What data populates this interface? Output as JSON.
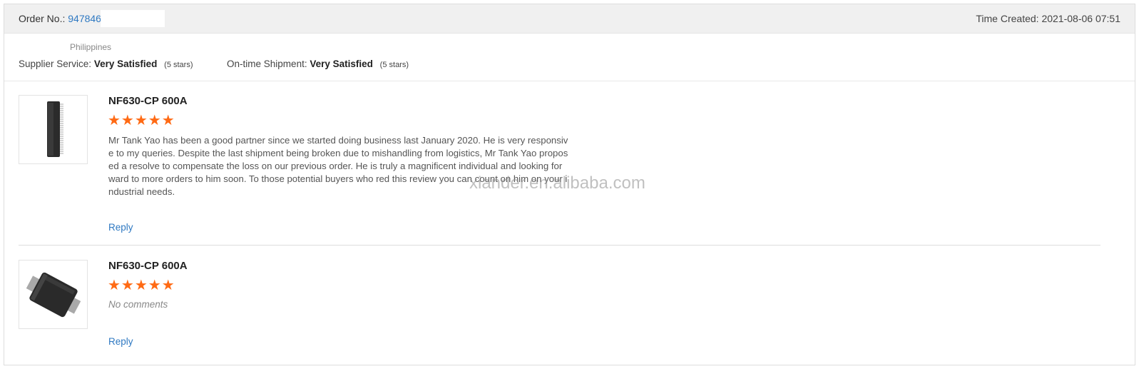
{
  "header": {
    "order_label": "Order No.:",
    "order_number": "9478463",
    "time_created_label": "Time Created:",
    "time_created": "2021-08-06 07:51"
  },
  "buyer": {
    "country": "Philippines"
  },
  "ratings": {
    "supplier_service_label": "Supplier Service:",
    "supplier_service_value": "Very Satisfied",
    "supplier_service_stars": "(5 stars)",
    "shipment_label": "On-time Shipment:",
    "shipment_value": "Very Satisfied",
    "shipment_stars": "(5 stars)"
  },
  "reviews": [
    {
      "product": "NF630-CP 600A",
      "stars": "★★★★★",
      "comment": "Mr Tank Yao has been a good partner since we started doing business last January 2020. He is very responsive to my queries. Despite the last shipment being broken due to mishandling from logistics, Mr Tank Yao proposed a resolve to compensate the loss on our previous order. He is truly a magnificent individual and looking forward to more orders to him soon. To those potential buyers who red this review you can count on him on your industrial needs.",
      "reply": "Reply",
      "image_icon": "dip-chip-icon"
    },
    {
      "product": "NF630-CP 600A",
      "stars": "★★★★★",
      "comment": "No comments",
      "reply": "Reply",
      "image_icon": "smd-diode-icon"
    }
  ],
  "watermark": "xiander.en.alibaba.com",
  "colors": {
    "link": "#2f79c2",
    "star": "#ff6a14",
    "header_bg": "#f0f0f0"
  }
}
